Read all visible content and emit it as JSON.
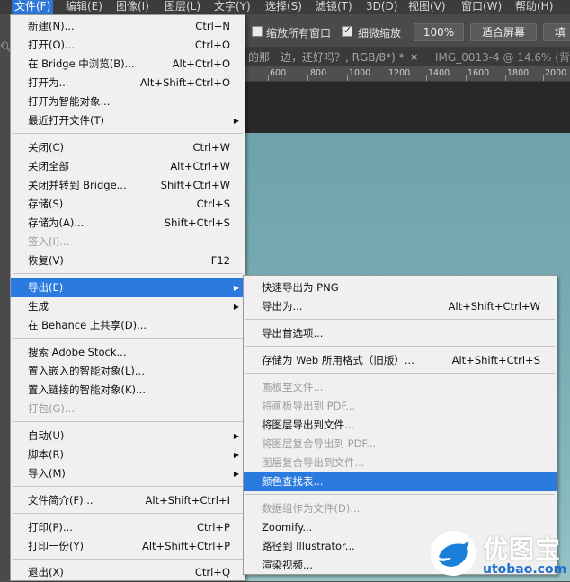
{
  "menubar": {
    "items": [
      "文件(F)",
      "编辑(E)",
      "图像(I)",
      "图层(L)",
      "文字(Y)",
      "选择(S)",
      "滤镜(T)",
      "3D(D)",
      "视图(V)",
      "窗口(W)",
      "帮助(H)"
    ]
  },
  "options": {
    "zoom_all_windows": {
      "label": "缩放所有窗口",
      "checked": false
    },
    "scrubby_zoom": {
      "label": "细微缩放",
      "checked": true
    },
    "zoom_level_button": "100%",
    "fit_screen_button": "适合屏幕",
    "fill_screen_button": "填"
  },
  "tabs": [
    {
      "label": "的那一边，还好吗？, RGB/8*) *",
      "close": "×"
    },
    {
      "label": "IMG_0013-4 @ 14.6% (背景",
      "close": ""
    }
  ],
  "ruler": {
    "labels": [
      "600",
      "800",
      "1000",
      "1200",
      "1400",
      "1600",
      "1800",
      "2000"
    ]
  },
  "file_menu": {
    "items": [
      {
        "label": "新建(N)...",
        "shortcut": "Ctrl+N"
      },
      {
        "label": "打开(O)...",
        "shortcut": "Ctrl+O"
      },
      {
        "label": "在 Bridge 中浏览(B)...",
        "shortcut": "Alt+Ctrl+O"
      },
      {
        "label": "打开为...",
        "shortcut": "Alt+Shift+Ctrl+O"
      },
      {
        "label": "打开为智能对象...",
        "shortcut": ""
      },
      {
        "label": "最近打开文件(T)",
        "shortcut": "",
        "submenu": true
      },
      {
        "label": "关闭(C)",
        "shortcut": "Ctrl+W"
      },
      {
        "label": "关闭全部",
        "shortcut": "Alt+Ctrl+W"
      },
      {
        "label": "关闭并转到 Bridge...",
        "shortcut": "Shift+Ctrl+W"
      },
      {
        "label": "存储(S)",
        "shortcut": "Ctrl+S"
      },
      {
        "label": "存储为(A)...",
        "shortcut": "Shift+Ctrl+S"
      },
      {
        "label": "签入(I)...",
        "shortcut": "",
        "disabled": true
      },
      {
        "label": "恢复(V)",
        "shortcut": "F12"
      },
      {
        "label": "导出(E)",
        "shortcut": "",
        "submenu": true,
        "highlighted": true
      },
      {
        "label": "生成",
        "shortcut": "",
        "submenu": true
      },
      {
        "label": "在 Behance 上共享(D)...",
        "shortcut": ""
      },
      {
        "label": "搜索 Adobe Stock...",
        "shortcut": ""
      },
      {
        "label": "置入嵌入的智能对象(L)...",
        "shortcut": ""
      },
      {
        "label": "置入链接的智能对象(K)...",
        "shortcut": ""
      },
      {
        "label": "打包(G)...",
        "shortcut": "",
        "disabled": true
      },
      {
        "label": "自动(U)",
        "shortcut": "",
        "submenu": true
      },
      {
        "label": "脚本(R)",
        "shortcut": "",
        "submenu": true
      },
      {
        "label": "导入(M)",
        "shortcut": "",
        "submenu": true
      },
      {
        "label": "文件简介(F)...",
        "shortcut": "Alt+Shift+Ctrl+I"
      },
      {
        "label": "打印(P)...",
        "shortcut": "Ctrl+P"
      },
      {
        "label": "打印一份(Y)",
        "shortcut": "Alt+Shift+Ctrl+P"
      },
      {
        "label": "退出(X)",
        "shortcut": "Ctrl+Q"
      }
    ]
  },
  "export_menu": {
    "items": [
      {
        "label": "快速导出为 PNG",
        "shortcut": ""
      },
      {
        "label": "导出为...",
        "shortcut": "Alt+Shift+Ctrl+W"
      },
      {
        "label": "导出首选项...",
        "shortcut": ""
      },
      {
        "label": "存储为 Web 所用格式（旧版）...",
        "shortcut": "Alt+Shift+Ctrl+S"
      },
      {
        "label": "画板至文件...",
        "shortcut": "",
        "disabled": true
      },
      {
        "label": "将画板导出到 PDF...",
        "shortcut": "",
        "disabled": true
      },
      {
        "label": "将图层导出到文件...",
        "shortcut": ""
      },
      {
        "label": "将图层复合导出到 PDF...",
        "shortcut": "",
        "disabled": true
      },
      {
        "label": "图层复合导出到文件...",
        "shortcut": "",
        "disabled": true
      },
      {
        "label": "颜色查找表...",
        "shortcut": "",
        "highlighted": true
      },
      {
        "label": "数据组作为文件(D)...",
        "shortcut": "",
        "disabled": true
      },
      {
        "label": "Zoomify...",
        "shortcut": ""
      },
      {
        "label": "路径到 Illustrator...",
        "shortcut": ""
      },
      {
        "label": "渲染视频...",
        "shortcut": ""
      }
    ]
  },
  "watermark": {
    "title": "优图宝",
    "subtitle": "utobao.com"
  },
  "colors": {
    "accent": "#2b7ae0",
    "menubar": "#3c3c3c",
    "canvas": "#79adb3"
  }
}
